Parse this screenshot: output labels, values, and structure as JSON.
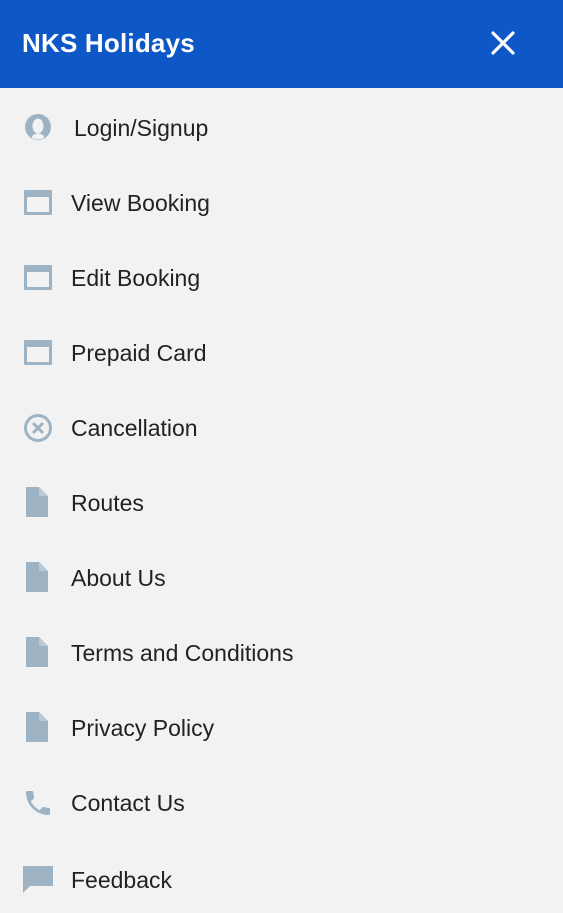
{
  "header": {
    "title": "NKS Holidays",
    "background_color": "#0d58c6"
  },
  "menu": {
    "icon_color": "#9db3c4",
    "items": [
      {
        "label": "Login/Signup",
        "icon": "account-icon"
      },
      {
        "label": "View Booking",
        "icon": "calendar-icon"
      },
      {
        "label": "Edit Booking",
        "icon": "calendar-icon"
      },
      {
        "label": "Prepaid Card",
        "icon": "calendar-icon"
      },
      {
        "label": "Cancellation",
        "icon": "cancel-circle-icon"
      },
      {
        "label": "Routes",
        "icon": "document-icon"
      },
      {
        "label": "About Us",
        "icon": "document-icon"
      },
      {
        "label": "Terms and Conditions",
        "icon": "document-icon"
      },
      {
        "label": "Privacy Policy",
        "icon": "document-icon"
      },
      {
        "label": "Contact Us",
        "icon": "phone-icon"
      },
      {
        "label": "Feedback",
        "icon": "chat-icon"
      }
    ]
  }
}
